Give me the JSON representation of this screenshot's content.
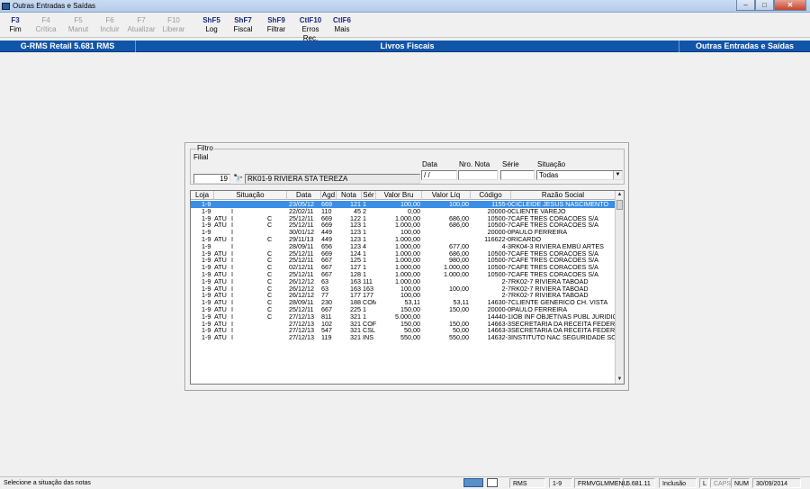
{
  "window": {
    "title": "Outras Entradas e Saídas",
    "min": "–",
    "max": "□",
    "close": "✕"
  },
  "toolbar": [
    {
      "key": "F3",
      "label": "Fim",
      "enabled": true
    },
    {
      "key": "F4",
      "label": "Crítica",
      "enabled": false
    },
    {
      "key": "F5",
      "label": "Manut",
      "enabled": false
    },
    {
      "key": "F6",
      "label": "Incluir",
      "enabled": false
    },
    {
      "key": "F7",
      "label": "Atualizar",
      "enabled": false
    },
    {
      "key": "F10",
      "label": "Liberar",
      "enabled": false
    },
    {
      "key": "ShF5",
      "label": "Log",
      "enabled": true
    },
    {
      "key": "ShF7",
      "label": "Fiscal",
      "enabled": true
    },
    {
      "key": "ShF9",
      "label": "Filtrar",
      "enabled": true
    },
    {
      "key": "CtlF10",
      "label": "Erros Rec.",
      "enabled": true
    },
    {
      "key": "CtlF6",
      "label": "Mais",
      "enabled": true
    }
  ],
  "header": {
    "app": "G-RMS Retail 5.681 RMS",
    "module": "Livros Fiscais",
    "screen": "Outras Entradas e Saídas"
  },
  "filtro": {
    "legend": "Filtro",
    "filial_label": "Filial",
    "filial_value": "19",
    "filial_name": "RK01-9 RIVIERA STA TEREZA",
    "data_label": "Data",
    "data_value": "/ /",
    "nota_label": "Nro. Nota",
    "nota_value": "",
    "serie_label": "Série",
    "serie_value": "",
    "situacao_label": "Situação",
    "situacao_value": "Todas",
    "dd_arrow": "▼",
    "binoc": "🔭"
  },
  "grid": {
    "columns": [
      "Loja",
      "Situação",
      "Data",
      "Agd",
      "Nota",
      "Sér",
      "Valor Bru",
      "Valor Líq",
      "Código",
      "Razão Social"
    ],
    "rows": [
      {
        "loja": "1-9",
        "s1": "",
        "s2": "",
        "s3": "",
        "data": "23/05/12",
        "agd": "669",
        "nota": "121",
        "ser": "1",
        "bru": "100,00",
        "liq": "100,00",
        "cod": "1155-0",
        "raz": "CICLEIDE JESUS NASCIMENTO"
      },
      {
        "loja": "1-9",
        "s1": "",
        "s2": "I",
        "s3": "",
        "data": "22/02/11",
        "agd": "110",
        "nota": "45",
        "ser": "2",
        "bru": "0,00",
        "liq": "",
        "cod": "20000-0",
        "raz": "CLIENTE VAREJO"
      },
      {
        "loja": "1-9",
        "s1": "ATU",
        "s2": "I",
        "s3": "C",
        "data": "25/12/11",
        "agd": "669",
        "nota": "122",
        "ser": "1",
        "bru": "1.000,00",
        "liq": "686,00",
        "cod": "10500-7",
        "raz": "CAFE TRES CORACOES S/A"
      },
      {
        "loja": "1-9",
        "s1": "ATU",
        "s2": "I",
        "s3": "C",
        "data": "25/12/11",
        "agd": "669",
        "nota": "123",
        "ser": "1",
        "bru": "1.000,00",
        "liq": "686,00",
        "cod": "10500-7",
        "raz": "CAFE TRES CORACOES S/A"
      },
      {
        "loja": "1-9",
        "s1": "",
        "s2": "I",
        "s3": "",
        "data": "30/01/12",
        "agd": "449",
        "nota": "123",
        "ser": "1",
        "bru": "100,00",
        "liq": "",
        "cod": "20000-0",
        "raz": "PAULO FERREIRA"
      },
      {
        "loja": "1-9",
        "s1": "ATU",
        "s2": "I",
        "s3": "C",
        "data": "29/11/13",
        "agd": "449",
        "nota": "123",
        "ser": "1",
        "bru": "1.000,00",
        "liq": "",
        "cod": "116622-0",
        "raz": "RICARDO"
      },
      {
        "loja": "1-9",
        "s1": "",
        "s2": "I",
        "s3": "",
        "data": "28/09/11",
        "agd": "656",
        "nota": "123",
        "ser": "4",
        "bru": "1.000,00",
        "liq": "677,00",
        "cod": "4-3",
        "raz": "RK04-3 RIVIERA EMBÚ ARTES"
      },
      {
        "loja": "1-9",
        "s1": "ATU",
        "s2": "I",
        "s3": "C",
        "data": "25/12/11",
        "agd": "669",
        "nota": "124",
        "ser": "1",
        "bru": "1.000,00",
        "liq": "686,00",
        "cod": "10500-7",
        "raz": "CAFE TRES CORACOES S/A"
      },
      {
        "loja": "1-9",
        "s1": "ATU",
        "s2": "I",
        "s3": "C",
        "data": "25/12/11",
        "agd": "667",
        "nota": "125",
        "ser": "1",
        "bru": "1.000,00",
        "liq": "980,00",
        "cod": "10500-7",
        "raz": "CAFE TRES CORACOES S/A"
      },
      {
        "loja": "1-9",
        "s1": "ATU",
        "s2": "I",
        "s3": "C",
        "data": "02/12/11",
        "agd": "667",
        "nota": "127",
        "ser": "1",
        "bru": "1.000,00",
        "liq": "1.000,00",
        "cod": "10500-7",
        "raz": "CAFE TRES CORACOES S/A"
      },
      {
        "loja": "1-9",
        "s1": "ATU",
        "s2": "I",
        "s3": "C",
        "data": "25/12/11",
        "agd": "667",
        "nota": "128",
        "ser": "1",
        "bru": "1.000,00",
        "liq": "1.000,00",
        "cod": "10500-7",
        "raz": "CAFE TRES CORACOES S/A"
      },
      {
        "loja": "1-9",
        "s1": "ATU",
        "s2": "I",
        "s3": "C",
        "data": "26/12/12",
        "agd": "63",
        "nota": "163",
        "ser": "111",
        "bru": "1.000,00",
        "liq": "",
        "cod": "2-7",
        "raz": "RK02-7 RIVIERA TABOAD"
      },
      {
        "loja": "1-9",
        "s1": "ATU",
        "s2": "I",
        "s3": "C",
        "data": "26/12/12",
        "agd": "63",
        "nota": "163",
        "ser": "163",
        "bru": "100,00",
        "liq": "100,00",
        "cod": "2-7",
        "raz": "RK02-7 RIVIERA TABOAD"
      },
      {
        "loja": "1-9",
        "s1": "ATU",
        "s2": "I",
        "s3": "C",
        "data": "26/12/12",
        "agd": "77",
        "nota": "177",
        "ser": "177",
        "bru": "100,00",
        "liq": "",
        "cod": "2-7",
        "raz": "RK02-7 RIVIERA TABOAD"
      },
      {
        "loja": "1-9",
        "s1": "ATU",
        "s2": "I",
        "s3": "C",
        "data": "28/09/11",
        "agd": "230",
        "nota": "188",
        "ser": "COM",
        "bru": "53,11",
        "liq": "53,11",
        "cod": "14630-7",
        "raz": "CLIENTE GENERICO CH. VISTA"
      },
      {
        "loja": "1-9",
        "s1": "ATU",
        "s2": "I",
        "s3": "C",
        "data": "25/12/11",
        "agd": "667",
        "nota": "225",
        "ser": "1",
        "bru": "150,00",
        "liq": "150,00",
        "cod": "20000-0",
        "raz": "PAULO FERREIRA"
      },
      {
        "loja": "1-9",
        "s1": "ATU",
        "s2": "I",
        "s3": "C",
        "data": "27/12/13",
        "agd": "811",
        "nota": "321",
        "ser": "1",
        "bru": "5.000,00",
        "liq": "",
        "cod": "14440-1",
        "raz": "IOB INF OBJETIVAS PUBL JURIDIC"
      },
      {
        "loja": "1-9",
        "s1": "ATU",
        "s2": "I",
        "s3": "",
        "data": "27/12/13",
        "agd": "102",
        "nota": "321",
        "ser": "COF",
        "bru": "150,00",
        "liq": "150,00",
        "cod": "14663-3",
        "raz": "SECRETARIA DA RECEITA FEDERA"
      },
      {
        "loja": "1-9",
        "s1": "ATU",
        "s2": "I",
        "s3": "",
        "data": "27/12/13",
        "agd": "547",
        "nota": "321",
        "ser": "CSL",
        "bru": "50,00",
        "liq": "50,00",
        "cod": "14663-3",
        "raz": "SECRETARIA DA RECEITA FEDERA"
      },
      {
        "loja": "1-9",
        "s1": "ATU",
        "s2": "I",
        "s3": "",
        "data": "27/12/13",
        "agd": "119",
        "nota": "321",
        "ser": "INS",
        "bru": "550,00",
        "liq": "550,00",
        "cod": "14632-3",
        "raz": "INSTITUTO NAC SEGURIDADE SOC"
      }
    ]
  },
  "status": {
    "message": "Selecione a situação das notas",
    "rms": "RMS",
    "loja": "1-9",
    "program": "FRMVGLMMENU",
    "version": "5.681.11",
    "mode": "Inclusão",
    "l": "L",
    "caps": "CAPS",
    "num": "NUM",
    "date": "30/09/2014"
  }
}
